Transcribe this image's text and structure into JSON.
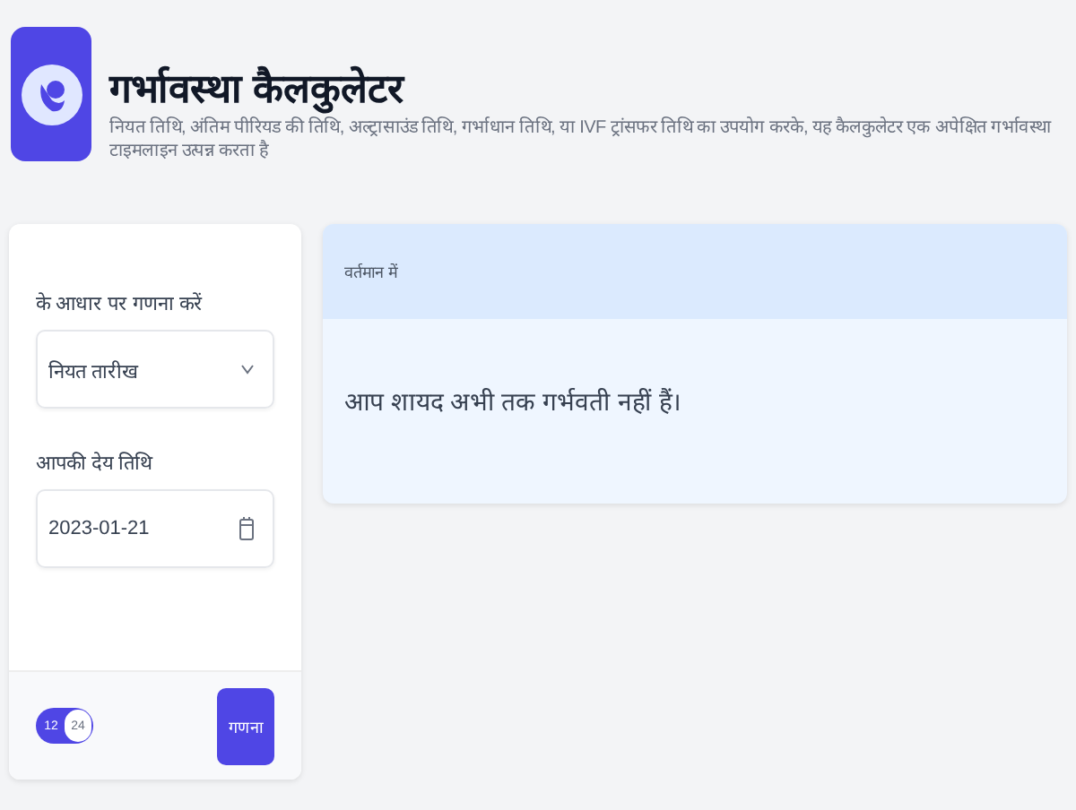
{
  "header": {
    "title": "गर्भावस्था कैलकुलेटर",
    "description": "नियत तिथि, अंतिम पीरियड की तिथि, अल्ट्रासाउंड तिथि, गर्भाधान तिथि, या IVF ट्रांसफर तिथि का उपयोग करके, यह कैलकुलेटर एक अपेक्षित गर्भावस्था टाइमलाइन उत्पन्न करता है"
  },
  "form": {
    "basis_label": "के आधार पर गणना करें",
    "basis_value": "नियत तारीख",
    "date_label": "आपकी देय तिथि",
    "date_value": "2023-01-21"
  },
  "clock_toggle": [
    {
      "label": "12",
      "selected": false
    },
    {
      "label": "24",
      "selected": true
    }
  ],
  "calculate_button": "गणना",
  "result": {
    "heading": "वर्तमान में",
    "message": "आप शायद अभी तक गर्भवती नहीं हैं।"
  }
}
